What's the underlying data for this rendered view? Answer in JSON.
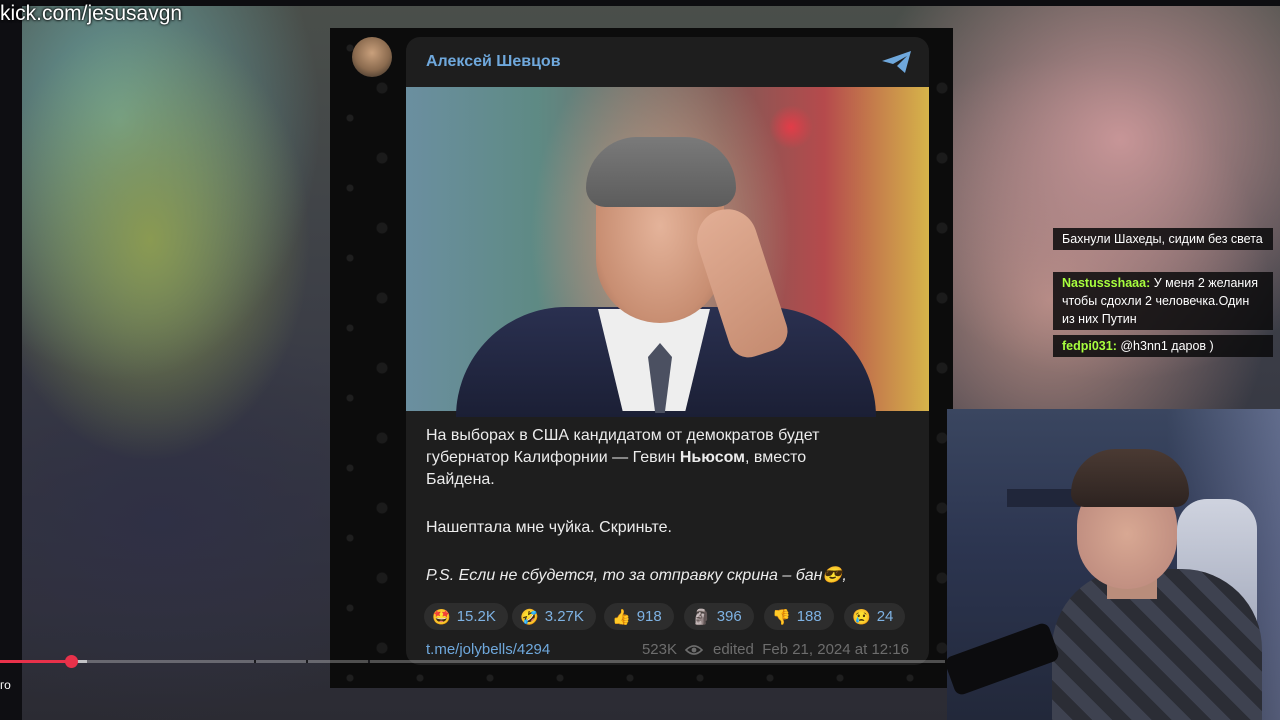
{
  "overlay": {
    "watermark": "kick.com/jesusavgn"
  },
  "player": {
    "progress_percent": 7.5,
    "label": "го"
  },
  "telegram_post": {
    "author": "Алексей Шевцов",
    "text_line1": "На выборах в США кандидатом от демократов будет",
    "text_line2a": "губернатор Калифорнии — Гевин ",
    "text_line2b": "Ньюсом",
    "text_line2c": ", вместо",
    "text_line3": "Байдена.",
    "text_para2": "Нашептала мне чуйка. Скриньте.",
    "text_ps": "P.S. Если не сбудется, то за отправку скрина – бан😎,",
    "reactions": [
      {
        "emoji": "🤩",
        "count": "15.2K"
      },
      {
        "emoji": "🤣",
        "count": "3.27K"
      },
      {
        "emoji": "👍",
        "count": "918"
      },
      {
        "emoji": "🗿",
        "count": "396"
      },
      {
        "emoji": "👎",
        "count": "188"
      },
      {
        "emoji": "😢",
        "count": "24"
      }
    ],
    "link": "t.me/jolybells/4294",
    "views": "523K",
    "edited": "edited",
    "timestamp": "Feb 21, 2024 at 12:16"
  },
  "chat": [
    {
      "user": "",
      "message": "Бахнули Шахеды, сидим без света",
      "user_color": "#ffffff"
    },
    {
      "user": "Nastussshaaa:",
      "message": " У меня 2 желания чтобы сдохли 2 человечка.Один из них Путин",
      "user_color": "#a8ff3e"
    },
    {
      "user": "fedpi031:",
      "message": " @h3nn1 даров )",
      "user_color": "#a8ff3e"
    }
  ],
  "colors": {
    "telegram_blue": "#6fa8dc",
    "chat_name": "#a8ff3e",
    "progress": "#e8314a"
  }
}
